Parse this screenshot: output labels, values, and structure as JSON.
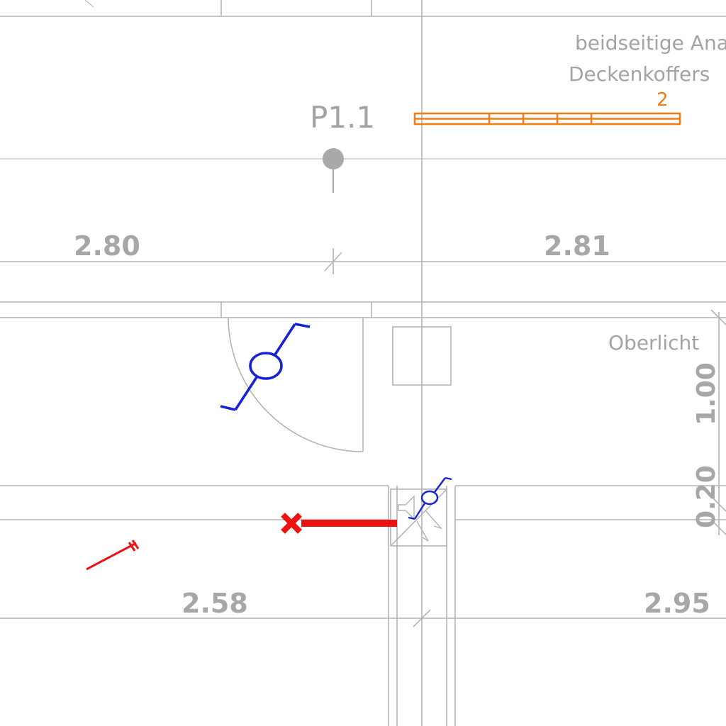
{
  "annotations": {
    "note_line1": "beidseitige Anarb",
    "note_line2": "Deckenkoffers",
    "orange_count": "2",
    "point_label": "P1.1",
    "skylight_label": "Oberlicht"
  },
  "dimensions": {
    "top_left": "2.80",
    "top_right": "2.81",
    "bottom_left": "2.58",
    "bottom_right": "2.95",
    "vertical_upper": "1.00",
    "vertical_lower": "0.20"
  },
  "colors": {
    "line": "#b4b4b4",
    "text": "#a7a7a7",
    "orange": "#ef7d1a",
    "blue": "#1522d6",
    "red": "#ee1111"
  },
  "symbols": {
    "switch_upper": "light-switch-icon",
    "switch_lower": "light-switch-icon",
    "speaker": "speaker-icon",
    "junction": "junction-point-icon",
    "cable": "cable-run-icon",
    "strip_light": "light-strip-icon"
  }
}
